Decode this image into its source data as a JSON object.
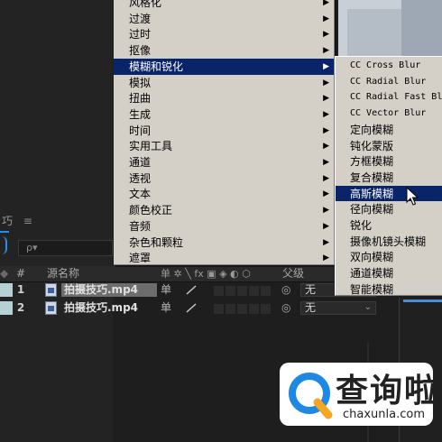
{
  "menu": {
    "items": [
      {
        "label": "风格化",
        "submenu": true
      },
      {
        "label": "过渡",
        "submenu": true
      },
      {
        "label": "过时",
        "submenu": true
      },
      {
        "label": "抠像",
        "submenu": true
      },
      {
        "label": "模糊和锐化",
        "submenu": true,
        "active": true
      },
      {
        "label": "模拟",
        "submenu": true
      },
      {
        "label": "扭曲",
        "submenu": true
      },
      {
        "label": "生成",
        "submenu": true
      },
      {
        "label": "时间",
        "submenu": true
      },
      {
        "label": "实用工具",
        "submenu": true
      },
      {
        "label": "通道",
        "submenu": true
      },
      {
        "label": "透视",
        "submenu": true
      },
      {
        "label": "文本",
        "submenu": true
      },
      {
        "label": "颜色校正",
        "submenu": true
      },
      {
        "label": "音频",
        "submenu": true
      },
      {
        "label": "杂色和颗粒",
        "submenu": true
      },
      {
        "label": "遮罩",
        "submenu": true
      }
    ]
  },
  "submenu": {
    "items": [
      {
        "label": "CC Cross Blur",
        "mono": true
      },
      {
        "label": "CC Radial Blur",
        "mono": true
      },
      {
        "label": "CC Radial Fast Blur",
        "mono": true
      },
      {
        "label": "CC Vector Blur",
        "mono": true
      },
      {
        "label": "定向模糊"
      },
      {
        "label": "钝化蒙版"
      },
      {
        "label": "方框模糊"
      },
      {
        "label": "复合模糊"
      },
      {
        "label": "高斯模糊",
        "active": true
      },
      {
        "label": "径向模糊"
      },
      {
        "label": "锐化"
      },
      {
        "label": "摄像机镜头模糊"
      },
      {
        "label": "双向模糊"
      },
      {
        "label": "通道模糊"
      },
      {
        "label": "智能模糊"
      }
    ]
  },
  "panel": {
    "tab_label": "巧",
    "menu_glyph": "≡",
    "search_icon": "search-icon",
    "search_text": "ρ▾"
  },
  "timeline": {
    "header": {
      "num": "#",
      "source_name": "源名称",
      "switch_icons": "单 ✲ ╲ fx ▣ ◈ ◐ ⬡",
      "parent": "父级"
    },
    "layers": [
      {
        "num": "1",
        "name": "拍摄技巧.mp4",
        "switch": "单",
        "parent": "无",
        "color": "#b5d1d6"
      },
      {
        "num": "2",
        "name": "拍摄技巧.mp4",
        "switch": "单",
        "parent": "无",
        "color": "#b5d1d6"
      }
    ]
  },
  "watermark": {
    "title": "查询啦",
    "url": "chaxunla.com"
  },
  "colors": {
    "menu_bg": "#d4d0c8",
    "menu_highlight": "#0a246a",
    "accent_blue": "#2d8ceb",
    "watermark_blue": "#1e88e5",
    "watermark_orange": "#f5a623"
  }
}
